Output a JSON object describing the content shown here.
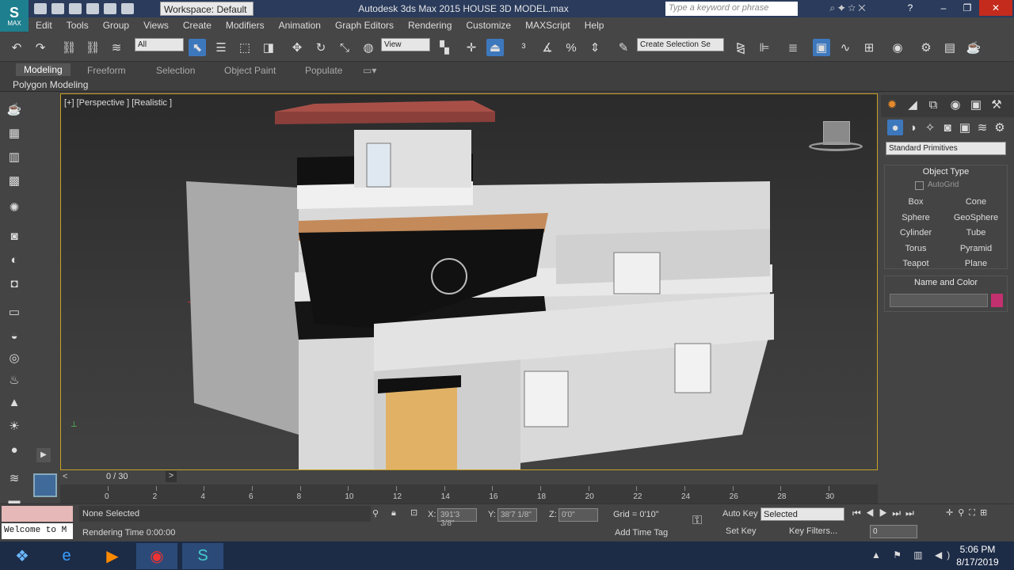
{
  "app": {
    "logo_label": "MAX",
    "workspace": "Workspace: Default",
    "title": "Autodesk 3ds Max  2015     HOUSE 3D MODEL.max",
    "search_placeholder": "Type a keyword or phrase"
  },
  "menu": [
    "Edit",
    "Tools",
    "Group",
    "Views",
    "Create",
    "Modifiers",
    "Animation",
    "Graph Editors",
    "Rendering",
    "Customize",
    "MAXScript",
    "Help"
  ],
  "toolbar": {
    "filter": "All",
    "ref_coord": "View",
    "selection_set": "Create Selection Se"
  },
  "ribbon": {
    "tabs": [
      "Modeling",
      "Freeform",
      "Selection",
      "Object Paint",
      "Populate"
    ],
    "panel": "Polygon Modeling"
  },
  "viewport": {
    "label": "[+] [Perspective ] [Realistic ]"
  },
  "command_panel": {
    "category": "Standard Primitives",
    "object_type_title": "Object Type",
    "autogrid": "AutoGrid",
    "buttons": [
      "Box",
      "Cone",
      "Sphere",
      "GeoSphere",
      "Cylinder",
      "Tube",
      "Torus",
      "Pyramid",
      "Teapot",
      "Plane"
    ],
    "name_color_title": "Name and Color",
    "swatch_color": "#c2306f"
  },
  "timeline": {
    "frame": "0 / 30",
    "ticks": [
      "0",
      "2",
      "4",
      "6",
      "8",
      "10",
      "12",
      "14",
      "16",
      "18",
      "20",
      "22",
      "24",
      "26",
      "28",
      "30"
    ]
  },
  "status": {
    "maxscript": "Welcome to M",
    "selected": "None Selected",
    "render_time": "Rendering Time  0:00:00",
    "x": "391'3 3/8\"",
    "y": "38'7 1/8\"",
    "z": "0'0\"",
    "x_label": "X:",
    "y_label": "Y:",
    "z_label": "Z:",
    "grid": "Grid = 0'10\"",
    "add_time_tag": "Add Time Tag",
    "auto_key": "Auto Key",
    "set_key": "Set Key",
    "key_mode": "Selected",
    "key_filters": "Key Filters...",
    "frame_value": "0"
  },
  "taskbar": {
    "time": "5:06 PM",
    "date": "8/17/2019"
  }
}
